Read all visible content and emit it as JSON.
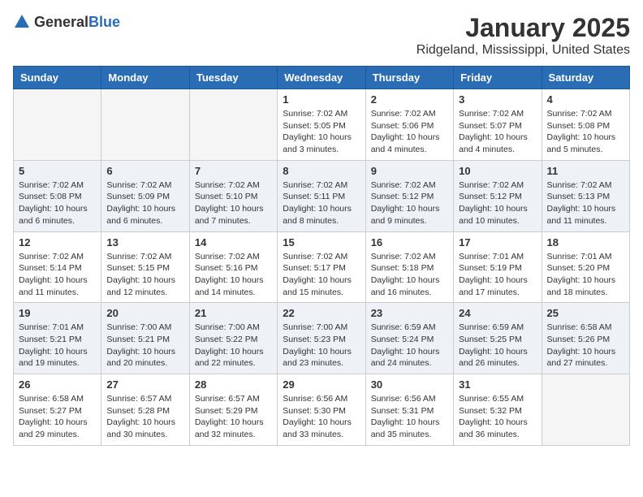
{
  "header": {
    "logo_general": "General",
    "logo_blue": "Blue",
    "month_title": "January 2025",
    "location": "Ridgeland, Mississippi, United States"
  },
  "days_of_week": [
    "Sunday",
    "Monday",
    "Tuesday",
    "Wednesday",
    "Thursday",
    "Friday",
    "Saturday"
  ],
  "weeks": [
    {
      "days": [
        {
          "number": "",
          "empty": true
        },
        {
          "number": "",
          "empty": true
        },
        {
          "number": "",
          "empty": true
        },
        {
          "number": "1",
          "sunrise": "7:02 AM",
          "sunset": "5:05 PM",
          "daylight": "10 hours and 3 minutes."
        },
        {
          "number": "2",
          "sunrise": "7:02 AM",
          "sunset": "5:06 PM",
          "daylight": "10 hours and 4 minutes."
        },
        {
          "number": "3",
          "sunrise": "7:02 AM",
          "sunset": "5:07 PM",
          "daylight": "10 hours and 4 minutes."
        },
        {
          "number": "4",
          "sunrise": "7:02 AM",
          "sunset": "5:08 PM",
          "daylight": "10 hours and 5 minutes."
        }
      ]
    },
    {
      "days": [
        {
          "number": "5",
          "sunrise": "7:02 AM",
          "sunset": "5:08 PM",
          "daylight": "10 hours and 6 minutes."
        },
        {
          "number": "6",
          "sunrise": "7:02 AM",
          "sunset": "5:09 PM",
          "daylight": "10 hours and 6 minutes."
        },
        {
          "number": "7",
          "sunrise": "7:02 AM",
          "sunset": "5:10 PM",
          "daylight": "10 hours and 7 minutes."
        },
        {
          "number": "8",
          "sunrise": "7:02 AM",
          "sunset": "5:11 PM",
          "daylight": "10 hours and 8 minutes."
        },
        {
          "number": "9",
          "sunrise": "7:02 AM",
          "sunset": "5:12 PM",
          "daylight": "10 hours and 9 minutes."
        },
        {
          "number": "10",
          "sunrise": "7:02 AM",
          "sunset": "5:12 PM",
          "daylight": "10 hours and 10 minutes."
        },
        {
          "number": "11",
          "sunrise": "7:02 AM",
          "sunset": "5:13 PM",
          "daylight": "10 hours and 11 minutes."
        }
      ]
    },
    {
      "days": [
        {
          "number": "12",
          "sunrise": "7:02 AM",
          "sunset": "5:14 PM",
          "daylight": "10 hours and 11 minutes."
        },
        {
          "number": "13",
          "sunrise": "7:02 AM",
          "sunset": "5:15 PM",
          "daylight": "10 hours and 12 minutes."
        },
        {
          "number": "14",
          "sunrise": "7:02 AM",
          "sunset": "5:16 PM",
          "daylight": "10 hours and 14 minutes."
        },
        {
          "number": "15",
          "sunrise": "7:02 AM",
          "sunset": "5:17 PM",
          "daylight": "10 hours and 15 minutes."
        },
        {
          "number": "16",
          "sunrise": "7:02 AM",
          "sunset": "5:18 PM",
          "daylight": "10 hours and 16 minutes."
        },
        {
          "number": "17",
          "sunrise": "7:01 AM",
          "sunset": "5:19 PM",
          "daylight": "10 hours and 17 minutes."
        },
        {
          "number": "18",
          "sunrise": "7:01 AM",
          "sunset": "5:20 PM",
          "daylight": "10 hours and 18 minutes."
        }
      ]
    },
    {
      "days": [
        {
          "number": "19",
          "sunrise": "7:01 AM",
          "sunset": "5:21 PM",
          "daylight": "10 hours and 19 minutes."
        },
        {
          "number": "20",
          "sunrise": "7:00 AM",
          "sunset": "5:21 PM",
          "daylight": "10 hours and 20 minutes."
        },
        {
          "number": "21",
          "sunrise": "7:00 AM",
          "sunset": "5:22 PM",
          "daylight": "10 hours and 22 minutes."
        },
        {
          "number": "22",
          "sunrise": "7:00 AM",
          "sunset": "5:23 PM",
          "daylight": "10 hours and 23 minutes."
        },
        {
          "number": "23",
          "sunrise": "6:59 AM",
          "sunset": "5:24 PM",
          "daylight": "10 hours and 24 minutes."
        },
        {
          "number": "24",
          "sunrise": "6:59 AM",
          "sunset": "5:25 PM",
          "daylight": "10 hours and 26 minutes."
        },
        {
          "number": "25",
          "sunrise": "6:58 AM",
          "sunset": "5:26 PM",
          "daylight": "10 hours and 27 minutes."
        }
      ]
    },
    {
      "days": [
        {
          "number": "26",
          "sunrise": "6:58 AM",
          "sunset": "5:27 PM",
          "daylight": "10 hours and 29 minutes."
        },
        {
          "number": "27",
          "sunrise": "6:57 AM",
          "sunset": "5:28 PM",
          "daylight": "10 hours and 30 minutes."
        },
        {
          "number": "28",
          "sunrise": "6:57 AM",
          "sunset": "5:29 PM",
          "daylight": "10 hours and 32 minutes."
        },
        {
          "number": "29",
          "sunrise": "6:56 AM",
          "sunset": "5:30 PM",
          "daylight": "10 hours and 33 minutes."
        },
        {
          "number": "30",
          "sunrise": "6:56 AM",
          "sunset": "5:31 PM",
          "daylight": "10 hours and 35 minutes."
        },
        {
          "number": "31",
          "sunrise": "6:55 AM",
          "sunset": "5:32 PM",
          "daylight": "10 hours and 36 minutes."
        },
        {
          "number": "",
          "empty": true
        }
      ]
    }
  ],
  "labels": {
    "sunrise": "Sunrise:",
    "sunset": "Sunset:",
    "daylight": "Daylight:"
  }
}
